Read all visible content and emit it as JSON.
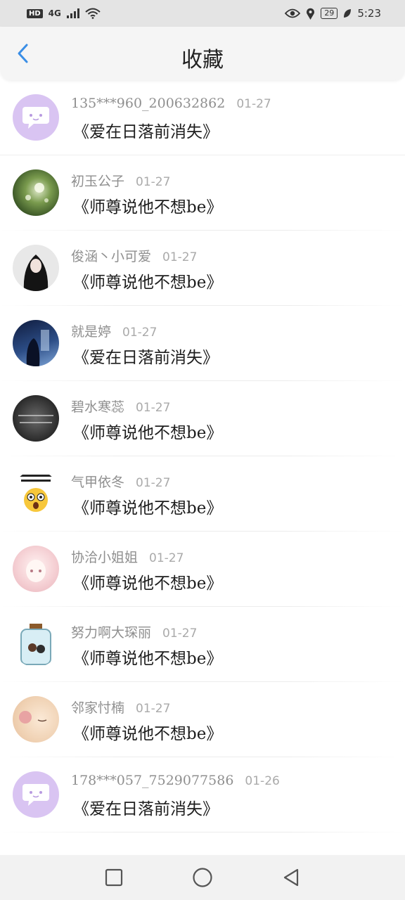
{
  "status_bar": {
    "network": "HD",
    "signal_label": "4G",
    "battery": "29",
    "time": "5:23"
  },
  "header": {
    "title": "收藏",
    "back_icon": "chevron-left-icon"
  },
  "favorites": [
    {
      "user": "135***960_200632862",
      "date": "01-27",
      "book": "《爱在日落前消失》",
      "avatar": "default-chat-avatar"
    },
    {
      "user": "初玉公子",
      "date": "01-27",
      "book": "《师尊说他不想be》",
      "avatar": "dandelion-photo-avatar"
    },
    {
      "user": "俊涵丶小可爱",
      "date": "01-27",
      "book": "《师尊说他不想be》",
      "avatar": "girl-portrait-avatar"
    },
    {
      "user": "就是婷",
      "date": "01-27",
      "book": "《爱在日落前消失》",
      "avatar": "anime-night-avatar"
    },
    {
      "user": "碧水寒蕊",
      "date": "01-27",
      "book": "《师尊说他不想be》",
      "avatar": "dark-text-avatar"
    },
    {
      "user": "气甲依冬",
      "date": "01-27",
      "book": "《师尊说他不想be》",
      "avatar": "shocked-emoji-avatar"
    },
    {
      "user": "协洽小姐姐",
      "date": "01-27",
      "book": "《师尊说他不想be》",
      "avatar": "anime-pink-hair-avatar"
    },
    {
      "user": "努力啊大琛丽",
      "date": "01-27",
      "book": "《师尊说他不想be》",
      "avatar": "bottle-couple-avatar"
    },
    {
      "user": "邻家忖楠",
      "date": "01-27",
      "book": "《师尊说他不想be》",
      "avatar": "sleeping-girl-avatar"
    },
    {
      "user": "178***057_7529077586",
      "date": "01-26",
      "book": "《爱在日落前消失》",
      "avatar": "default-chat-avatar"
    }
  ],
  "colors": {
    "accent": "#3a8ee6",
    "default_avatar": "#d9c4f2",
    "username": "#8f8f8f",
    "status_bar_bg": "#e4e4e4"
  },
  "nav": [
    "recents-square-icon",
    "home-circle-icon",
    "back-triangle-icon"
  ]
}
